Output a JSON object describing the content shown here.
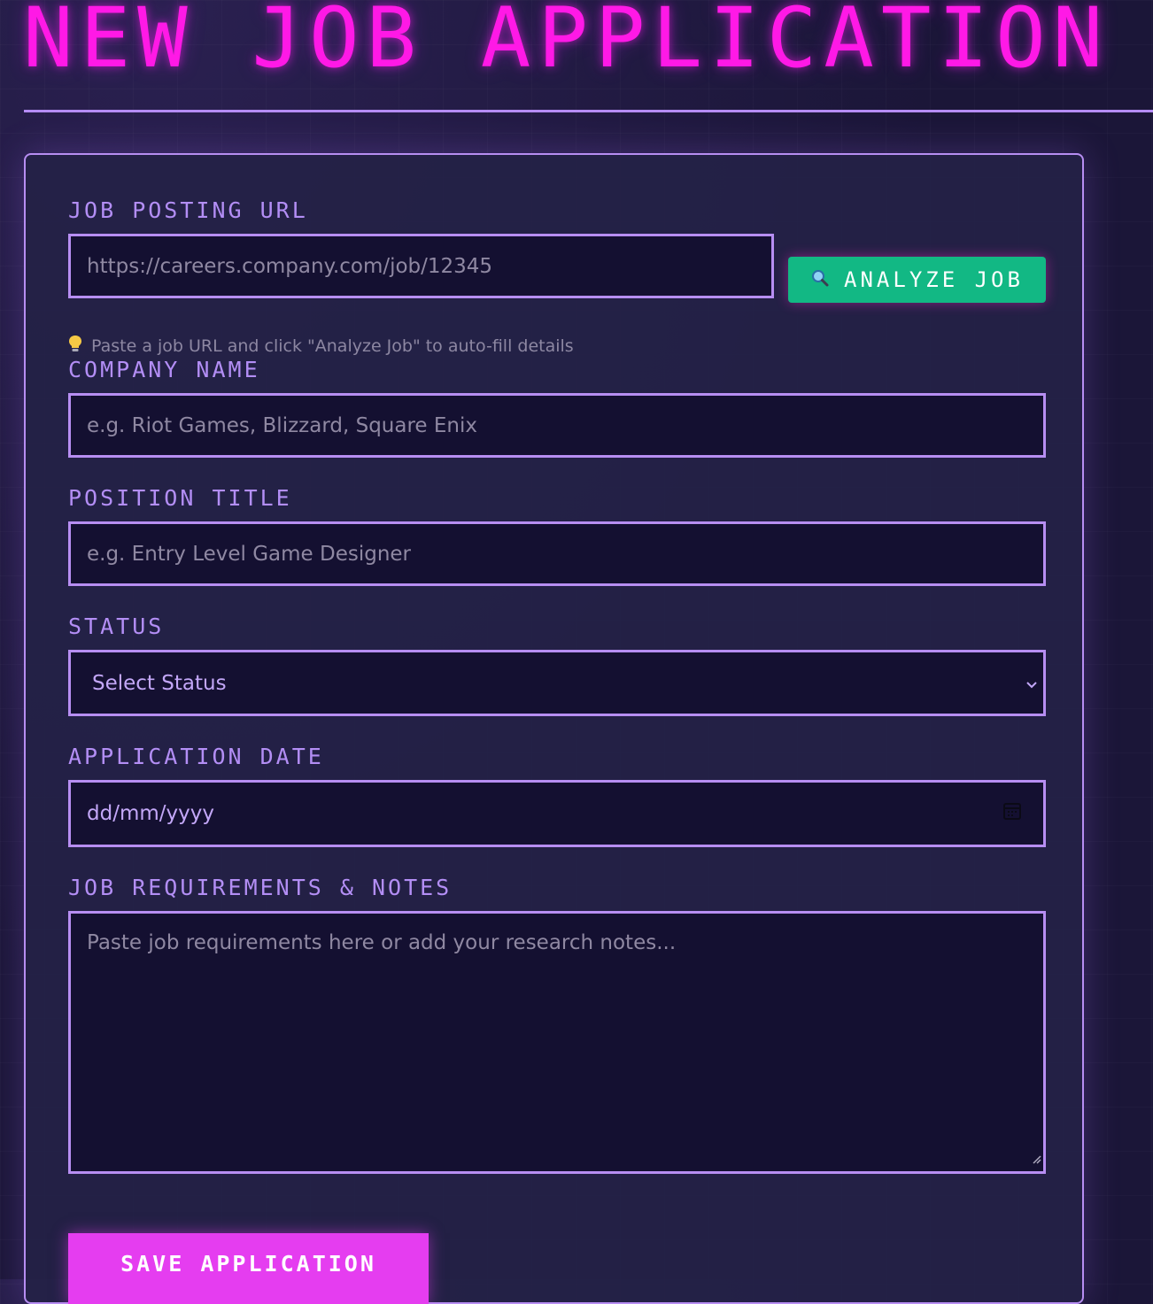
{
  "page": {
    "title": "NEW JOB APPLICATION"
  },
  "form": {
    "job_url": {
      "label": "JOB POSTING URL",
      "placeholder": "https://careers.company.com/job/12345"
    },
    "analyze_button": {
      "label": "ANALYZE JOB",
      "icon": "magnifier-icon"
    },
    "hint": {
      "icon": "lightbulb-icon",
      "text": "Paste a job URL and click \"Analyze Job\" to auto-fill details"
    },
    "company": {
      "label": "COMPANY NAME",
      "placeholder": "e.g. Riot Games, Blizzard, Square Enix"
    },
    "position": {
      "label": "POSITION TITLE",
      "placeholder": "e.g. Entry Level Game Designer"
    },
    "status": {
      "label": "STATUS",
      "selected": "Select Status"
    },
    "application_date": {
      "label": "APPLICATION DATE",
      "placeholder": "dd/mm/yyyy"
    },
    "notes": {
      "label": "JOB REQUIREMENTS & NOTES",
      "placeholder": "Paste job requirements here or add your research notes..."
    },
    "save_button": {
      "label": "SAVE APPLICATION"
    }
  },
  "colors": {
    "title": "#ff19e6",
    "accent": "#b78ef2",
    "analyze_button": "#12b884",
    "save_button": "#e53df0",
    "input_background": "#141031"
  }
}
